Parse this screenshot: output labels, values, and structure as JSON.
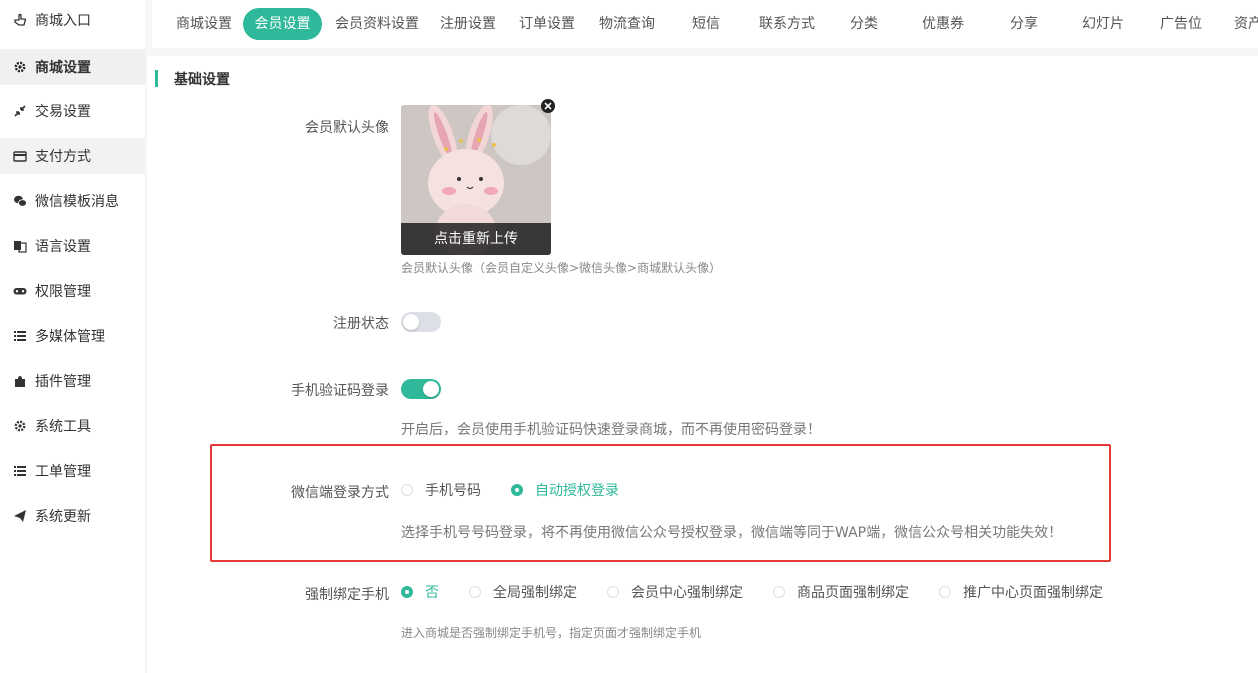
{
  "sidebar": {
    "items": [
      {
        "label": "商城入口",
        "icon": "hand-pointer-icon"
      },
      {
        "label": "商城设置",
        "icon": "gear-icon"
      },
      {
        "label": "交易设置",
        "icon": "compress-arrows-icon"
      },
      {
        "label": "支付方式",
        "icon": "credit-card-icon"
      },
      {
        "label": "微信模板消息",
        "icon": "wechat-icon"
      },
      {
        "label": "语言设置",
        "icon": "language-icon"
      },
      {
        "label": "权限管理",
        "icon": "gamepad-icon"
      },
      {
        "label": "多媒体管理",
        "icon": "list-icon"
      },
      {
        "label": "插件管理",
        "icon": "puzzle-icon"
      },
      {
        "label": "系统工具",
        "icon": "gear-icon"
      },
      {
        "label": "工单管理",
        "icon": "list-icon"
      },
      {
        "label": "系统更新",
        "icon": "paper-plane-icon"
      }
    ],
    "active_index": 1,
    "hover_index": 3
  },
  "tabs": [
    "商城设置",
    "会员设置",
    "会员资料设置",
    "注册设置",
    "订单设置",
    "物流查询",
    "短信",
    "联系方式",
    "分类",
    "优惠券",
    "分享",
    "幻灯片",
    "广告位",
    "资产"
  ],
  "active_tab": "会员设置",
  "section_title": "基础设置",
  "avatar": {
    "label": "会员默认头像",
    "reupload": "点击重新上传",
    "hint": "会员默认头像（会员自定义头像>微信头像>商城默认头像）"
  },
  "register_status": {
    "label": "注册状态",
    "enabled": false
  },
  "sms_login": {
    "label": "手机验证码登录",
    "enabled": true,
    "hint": "开启后，会员使用手机验证码快速登录商城，而不再使用密码登录！"
  },
  "wechat_login": {
    "label": "微信端登录方式",
    "options": [
      "手机号码",
      "自动授权登录"
    ],
    "selected": "自动授权登录",
    "hint": "选择手机号号码登录，将不再使用微信公众号授权登录，微信端等同于WAP端，微信公众号相关功能失效！"
  },
  "force_bind": {
    "label": "强制绑定手机",
    "options": [
      "否",
      "全局强制绑定",
      "会员中心强制绑定",
      "商品页面强制绑定",
      "推广中心页面强制绑定"
    ],
    "selected": "否",
    "hint": "进入商城是否强制绑定手机号，指定页面才强制绑定手机"
  },
  "colors": {
    "accent": "#2fb99a",
    "highlight_box": "#e53935"
  }
}
